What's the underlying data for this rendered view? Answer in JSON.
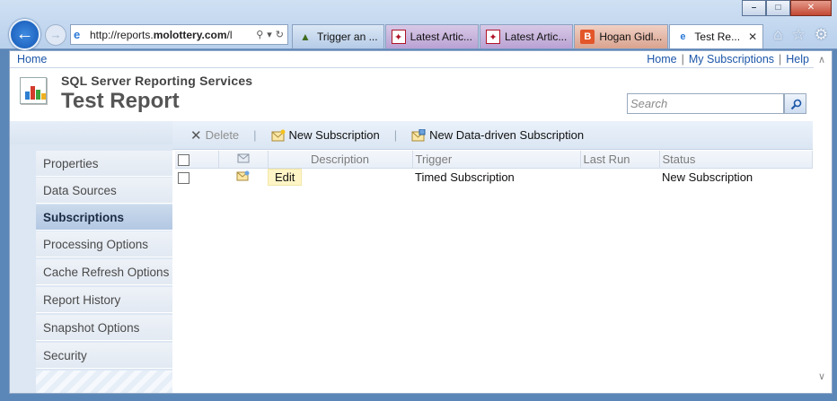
{
  "browser": {
    "address": {
      "url_prefix": "http://reports.",
      "url_domain": "molottery.com",
      "url_suffix": "/l"
    },
    "tabs": [
      {
        "label": "Trigger an ...",
        "icon": "pyramid-icon"
      },
      {
        "label": "Latest Artic...",
        "icon": "star-icon"
      },
      {
        "label": "Latest Artic...",
        "icon": "star-icon"
      },
      {
        "label": "Hogan Gidl...",
        "icon": "blogger-icon"
      },
      {
        "label": "Test Re...",
        "icon": "ie-icon",
        "active": true
      }
    ],
    "window_buttons": [
      "minimize",
      "restore",
      "close"
    ]
  },
  "topbar": {
    "left_link": "Home",
    "links": [
      "Home",
      "My Subscriptions",
      "Help"
    ],
    "separator": "|"
  },
  "header": {
    "app_title": "SQL Server Reporting Services",
    "page_title": "Test Report",
    "search_placeholder": "Search"
  },
  "sidebar": {
    "items": [
      {
        "label": "Properties"
      },
      {
        "label": "Data Sources"
      },
      {
        "label": "Subscriptions",
        "active": true
      },
      {
        "label": "Processing Options"
      },
      {
        "label": "Cache Refresh Options"
      },
      {
        "label": "Report History"
      },
      {
        "label": "Snapshot Options"
      },
      {
        "label": "Security"
      }
    ]
  },
  "toolbar": {
    "delete_label": "Delete",
    "new_subscription_label": "New Subscription",
    "new_data_driven_label": "New Data-driven Subscription"
  },
  "table": {
    "columns": [
      "Description",
      "Trigger",
      "Last Run",
      "Status"
    ],
    "rows": [
      {
        "edit_label": "Edit",
        "description": "",
        "trigger": "Timed Subscription",
        "last_run": "",
        "status": "New Subscription"
      }
    ]
  },
  "colors": {
    "link": "#1c56a8",
    "accent": "#5b86b8",
    "active_nav": "#b3c8e3"
  }
}
